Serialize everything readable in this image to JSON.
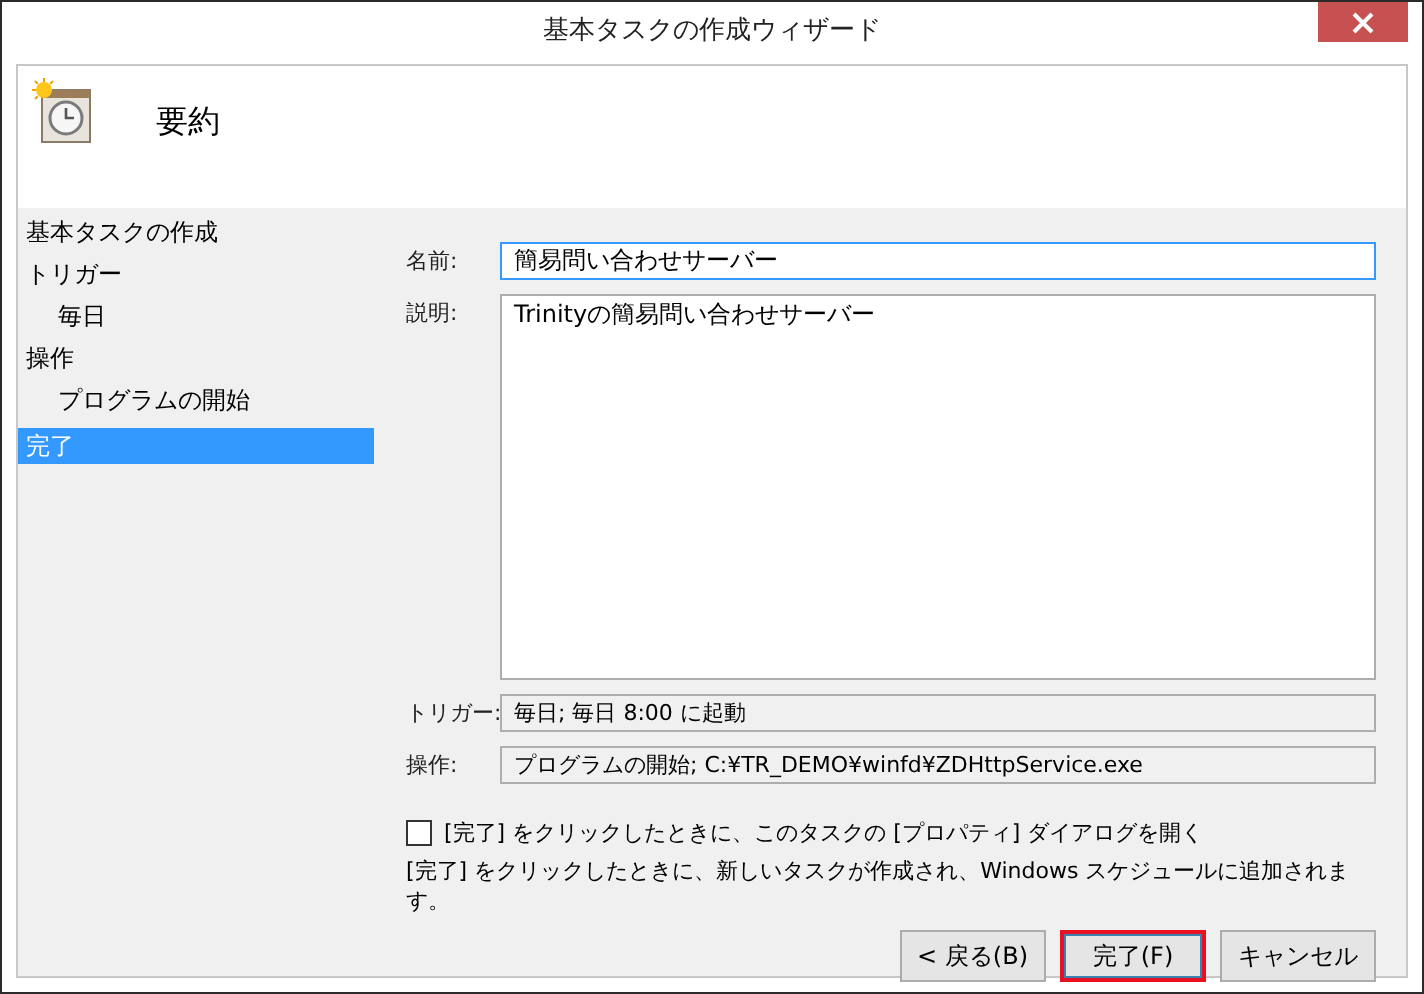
{
  "window": {
    "title": "基本タスクの作成ウィザード"
  },
  "header": {
    "title": "要約"
  },
  "steps": [
    {
      "label": "基本タスクの作成",
      "selected": false
    },
    {
      "label": "トリガー",
      "selected": false,
      "children": [
        {
          "label": "毎日",
          "selected": false
        }
      ]
    },
    {
      "label": "操作",
      "selected": false,
      "children": [
        {
          "label": "プログラムの開始",
          "selected": false
        }
      ]
    },
    {
      "label": "完了",
      "selected": true
    }
  ],
  "fields": [
    {
      "kind": "edit",
      "label": "名前:",
      "value": "簡易問い合わせサーバー",
      "focused": true
    },
    {
      "kind": "memo",
      "label": "説明:",
      "value": "Trinityの簡易問い合わせサーバー",
      "focused": false
    },
    {
      "kind": "readonly",
      "label": "トリガー:",
      "value": "毎日; 毎日  8:00 に起動",
      "focused": false
    },
    {
      "kind": "readonly",
      "label": "操作:",
      "value": "プログラムの開始; C:¥TR_DEMO¥winfd¥ZDHttpService.exe",
      "focused": false
    }
  ],
  "open_properties": {
    "label": "[完了] をクリックしたときに、このタスクの [プロパティ] ダイアログを開く",
    "checked": false
  },
  "note": "[完了] をクリックしたときに、新しいタスクが作成され、Windows スケジュールに追加されます。",
  "buttons": [
    {
      "label": "< 戻る(B)",
      "highlighted": false
    },
    {
      "label": "完了(F)",
      "highlighted": true
    },
    {
      "label": "キャンセル",
      "highlighted": false
    }
  ]
}
